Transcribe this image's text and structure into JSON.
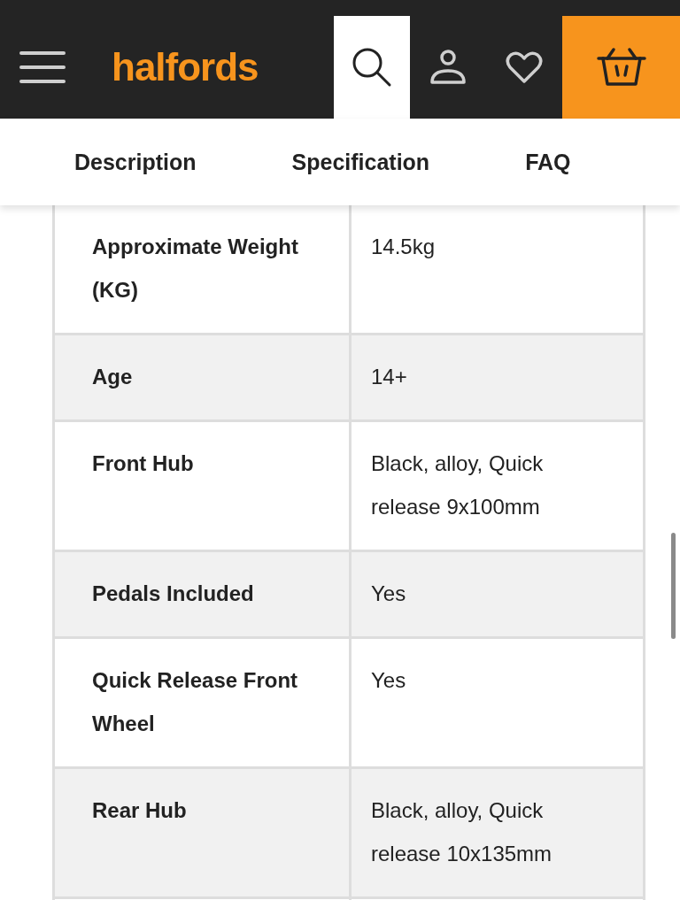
{
  "header": {
    "logo": "halfords",
    "search_active": true
  },
  "tabs": [
    {
      "label": "Description"
    },
    {
      "label": "Specification"
    },
    {
      "label": "FAQ"
    }
  ],
  "specs": [
    {
      "name": "Approximate Weight (KG)",
      "value": "14.5kg"
    },
    {
      "name": "Age",
      "value": "14+"
    },
    {
      "name": "Front Hub",
      "value": "Black, alloy, Quick release 9x100mm"
    },
    {
      "name": "Pedals Included",
      "value": "Yes"
    },
    {
      "name": "Quick Release Front Wheel",
      "value": "Yes"
    },
    {
      "name": "Rear Hub",
      "value": "Black, alloy, Quick release 10x135mm"
    }
  ]
}
